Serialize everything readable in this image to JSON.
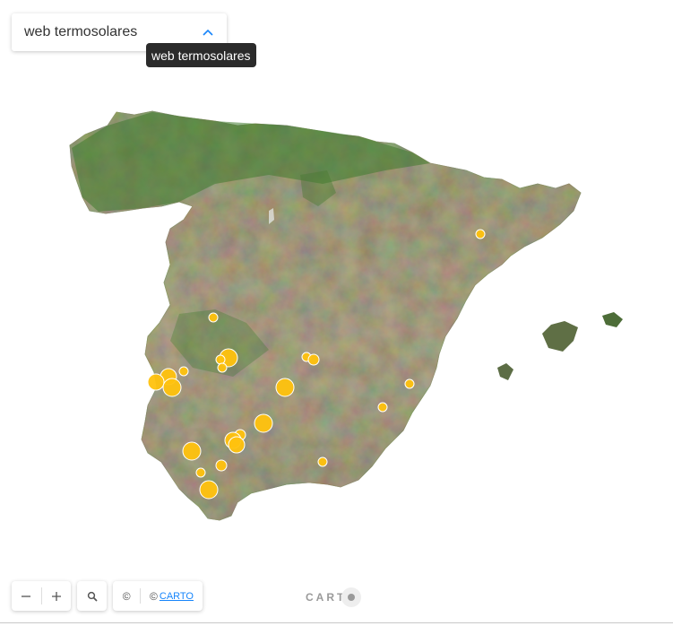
{
  "layer_selector": {
    "label": "web termosolares"
  },
  "tooltip": {
    "text": "web termosolares"
  },
  "controls": {
    "zoom_out_label": "−",
    "zoom_in_label": "+",
    "attribution_copyright": "©",
    "attribution_prefix": "©",
    "attribution_link": "CARTO"
  },
  "logo": {
    "text": "CART"
  },
  "colors": {
    "point_fill": "#ffc20e",
    "point_stroke": "#ffffff",
    "tooltip_bg": "#2b2b2b",
    "link": "#1785fb"
  },
  "icons": [
    "chevron-up-icon",
    "zoom-out-icon",
    "zoom-in-icon",
    "search-icon",
    "carto-logo"
  ]
}
